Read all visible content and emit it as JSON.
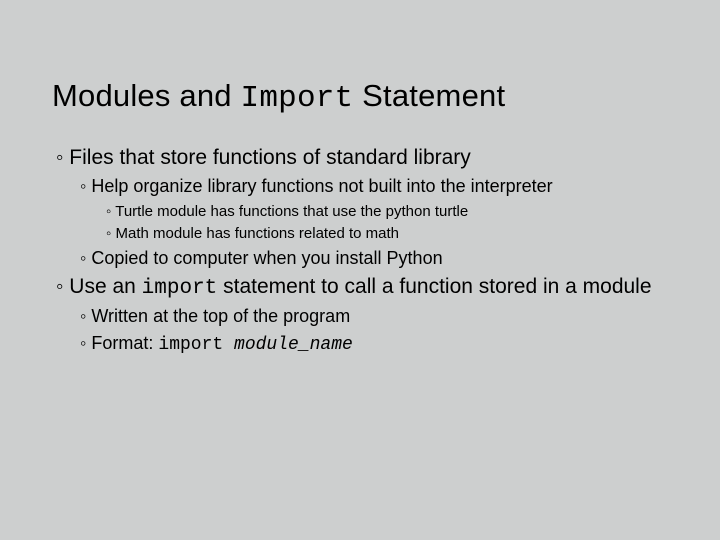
{
  "title": {
    "t1": "Modules and ",
    "t2": "Import",
    "t3": " Statement"
  },
  "b1": "◦ Files that store functions of standard library",
  "b1_1": "◦ Help organize library functions not built into the interpreter",
  "b1_1_1": "◦  Turtle module has functions that use the python turtle",
  "b1_1_2": "◦  Math module has functions related to math",
  "b1_2": "◦ Copied to computer when you install Python",
  "b2": {
    "p1": "◦ Use an ",
    "p2": "import",
    "p3": " statement to call a function stored in a module"
  },
  "b2_1": "◦ Written at the top of the program",
  "b2_2": {
    "p1": "◦ Format: ",
    "p2": "import ",
    "p3": "module_name"
  }
}
